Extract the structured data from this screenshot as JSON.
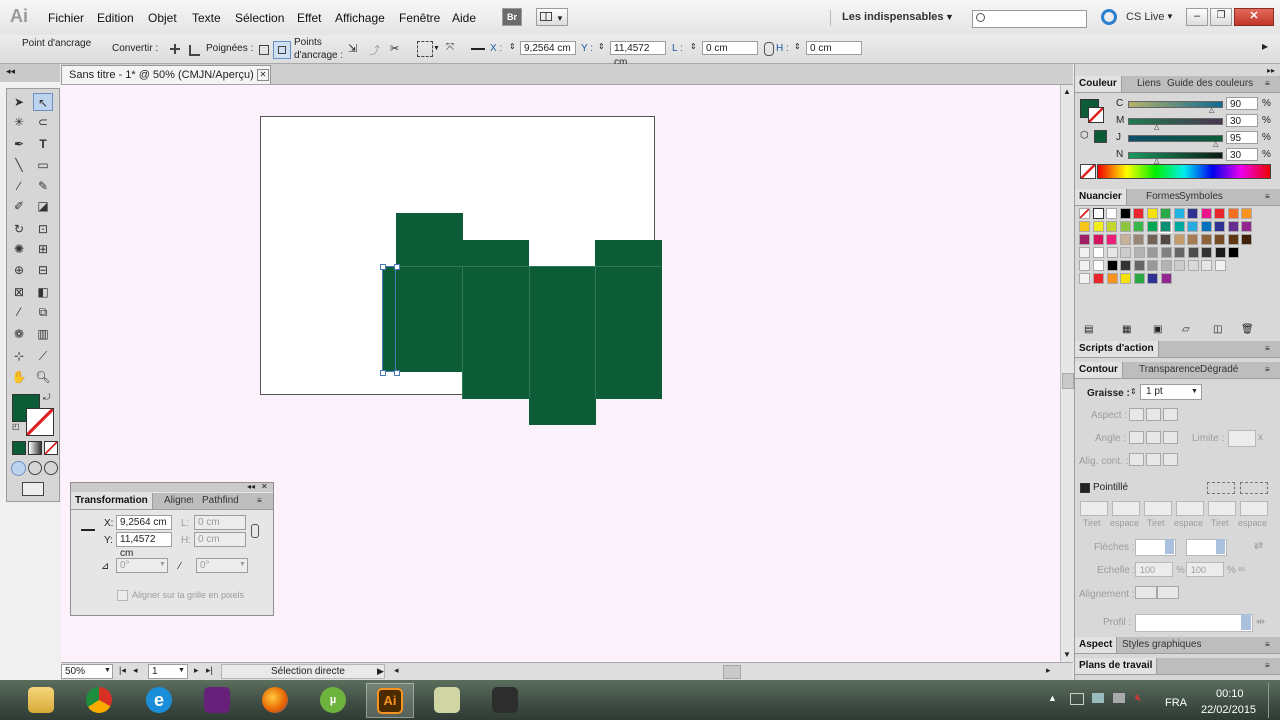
{
  "menubar": {
    "logo": "Ai",
    "menu": [
      "Fichier",
      "Edition",
      "Objet",
      "Texte",
      "Sélection",
      "Effet",
      "Affichage",
      "Fenêtre",
      "Aide"
    ],
    "bridge": "Br",
    "workspace": "Les indispensables",
    "cs_live": "CS Live"
  },
  "controlbar": {
    "label_point": "Point d'ancrage",
    "label_convert": "Convertir :",
    "label_handles": "Poignées :",
    "label_points_1": "Points",
    "label_points_2": "d'ancrage :",
    "x_label": "X :",
    "x_value": "9,2564 cm",
    "y_label": "Y :",
    "y_value": "11,4572 cm",
    "l_label": "L :",
    "l_value": "0 cm",
    "h_label": "H :",
    "h_value": "0 cm"
  },
  "document": {
    "tab_title": "Sans titre - 1* @ 50% (CMJN/Aperçu)"
  },
  "statusbar": {
    "zoom": "50%",
    "page": "1",
    "tool": "Sélection directe"
  },
  "colors": {
    "shape_fill": "#0b5c37",
    "canvas_bg": "#fbf2fb",
    "selection": "#4a7ab5"
  },
  "color_panel": {
    "tabs": [
      "Couleur",
      "Liens",
      "Guide des couleurs"
    ],
    "channels": [
      {
        "label": "C",
        "value": "90"
      },
      {
        "label": "M",
        "value": "30"
      },
      {
        "label": "J",
        "value": "95"
      },
      {
        "label": "N",
        "value": "30"
      }
    ],
    "unit": "%"
  },
  "swatches_panel": {
    "tabs": [
      "Nuancier",
      "Formes",
      "Symboles"
    ]
  },
  "actions_panel": {
    "title": "Scripts d'action"
  },
  "stroke_panel": {
    "tabs": [
      "Contour",
      "Transparence",
      "Dégradé"
    ],
    "weight_label": "Graisse :",
    "weight_value": "1 pt",
    "aspect_label": "Aspect :",
    "angle_label": "Angle :",
    "limit_label": "Limite :",
    "align_label": "Alig. cont. :",
    "dashed_label": "Pointillé",
    "dash_labels": [
      "Tiret",
      "espace",
      "Tiret",
      "espace",
      "Tiret",
      "espace"
    ],
    "arrows_label": "Flèches :",
    "scale_label": "Echelle :",
    "scale_1": "100",
    "scale_2": "100",
    "unit": "%",
    "alignment_label": "Alignement :",
    "profile_label": "Profil :"
  },
  "appearance_panel": {
    "tabs": [
      "Aspect",
      "Styles graphiques"
    ]
  },
  "artboards_panel": {
    "title": "Plans de travail"
  },
  "transform_panel": {
    "tabs": [
      "Transformation",
      "Aligner",
      "Pathfinder"
    ],
    "x_label": "X:",
    "x_value": "9,2564 cm",
    "y_label": "Y:",
    "y_value": "11,4572 cm",
    "l_label": "L:",
    "l_value": "0 cm",
    "h_label": "H:",
    "h_value": "0 cm",
    "rotate_value": "0°",
    "shear_value": "0°",
    "pixel_grid": "Aligner sur la grille en pixels"
  },
  "taskbar": {
    "language": "FRA",
    "time": "00:10",
    "date": "22/02/2015",
    "apps": [
      "file-explorer",
      "chrome",
      "internet-explorer",
      "visual-studio",
      "firefox",
      "utorrent",
      "illustrator",
      "notepad",
      "media-app"
    ]
  }
}
